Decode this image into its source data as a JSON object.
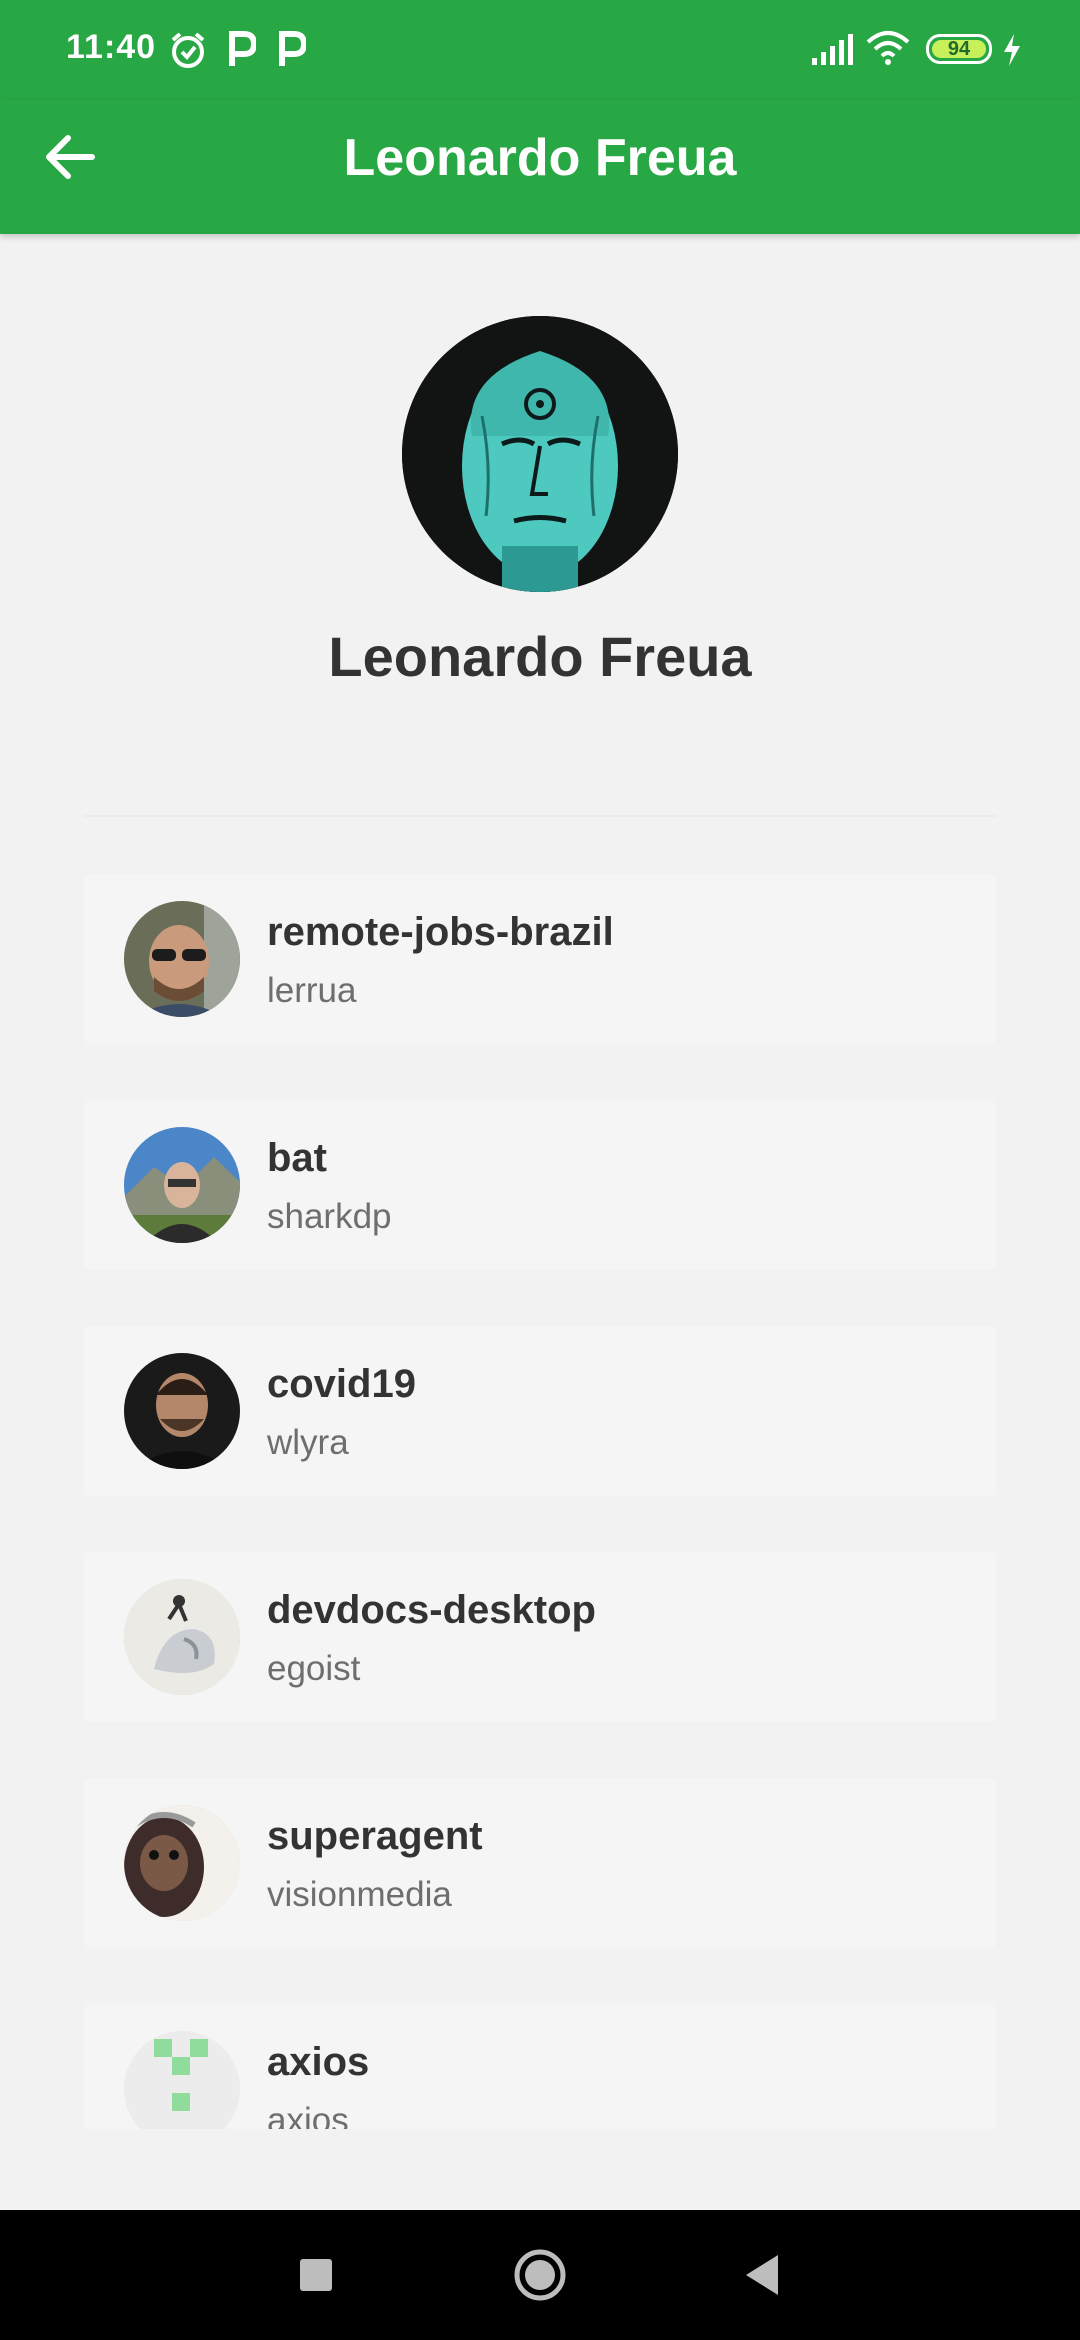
{
  "status_bar": {
    "time": "11:40",
    "battery": "94",
    "icons": [
      "alarm-icon",
      "parking-icon",
      "parking-icon",
      "signal-icon",
      "wifi-icon",
      "battery-icon",
      "charging-icon"
    ]
  },
  "app_bar": {
    "title": "Leonardo Freua",
    "back_icon": "arrow-left-icon",
    "color": "#28a745"
  },
  "profile": {
    "name": "Leonardo Freua",
    "avatar_icon": "profile-avatar"
  },
  "repositories": [
    {
      "name": "remote-jobs-brazil",
      "owner": "lerrua"
    },
    {
      "name": "bat",
      "owner": "sharkdp"
    },
    {
      "name": "covid19",
      "owner": "wlyra"
    },
    {
      "name": "devdocs-desktop",
      "owner": "egoist"
    },
    {
      "name": "superagent",
      "owner": "visionmedia"
    },
    {
      "name": "axios",
      "owner": "axios"
    }
  ],
  "nav_bar": {
    "buttons": [
      "recents-icon",
      "home-icon",
      "back-icon"
    ]
  }
}
